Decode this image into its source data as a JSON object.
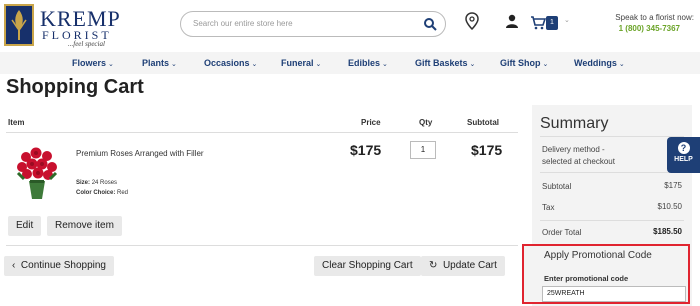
{
  "brand": {
    "name": "KREMP",
    "sub": "FLORIST",
    "tagline": "...feel special"
  },
  "search": {
    "placeholder": "Search our entire store here"
  },
  "header": {
    "cart_count": "1",
    "speak_label": "Speak to a florist now:",
    "phone": "1 (800) 345-7367"
  },
  "nav": {
    "items": [
      {
        "label": "Flowers"
      },
      {
        "label": "Plants"
      },
      {
        "label": "Occasions"
      },
      {
        "label": "Funeral"
      },
      {
        "label": "Edibles"
      },
      {
        "label": "Gift Baskets"
      },
      {
        "label": "Gift Shop"
      },
      {
        "label": "Weddings"
      }
    ]
  },
  "page": {
    "title": "Shopping Cart"
  },
  "cart": {
    "columns": {
      "item": "Item",
      "price": "Price",
      "qty": "Qty",
      "subtotal": "Subtotal"
    },
    "product": {
      "name": "Premium Roses Arranged with Filler",
      "price": "$175",
      "qty": "1",
      "subtotal": "$175",
      "size_label": "Size:",
      "size_value": "24 Roses",
      "color_label": "Color Choice:",
      "color_value": "Red"
    },
    "edit_label": "Edit",
    "remove_label": "Remove item",
    "continue_label": "Continue Shopping",
    "clear_label": "Clear Shopping Cart",
    "update_label": "Update Cart"
  },
  "summary": {
    "title": "Summary",
    "delivery_line1": "Delivery method -",
    "delivery_line2": "selected at checkout",
    "subtotal_label": "Subtotal",
    "subtotal_value": "$175",
    "tax_label": "Tax",
    "tax_value": "$10.50",
    "total_label": "Order Total",
    "total_value": "$185.50"
  },
  "help": {
    "label": "HELP",
    "glyph": "?"
  },
  "promo": {
    "title": "Apply Promotional Code",
    "field_label": "Enter promotional code",
    "value": "25WREATH"
  },
  "colors": {
    "brand_navy": "#1e3f76",
    "phone_green": "#6ba428",
    "highlight_red": "#e0242f"
  }
}
